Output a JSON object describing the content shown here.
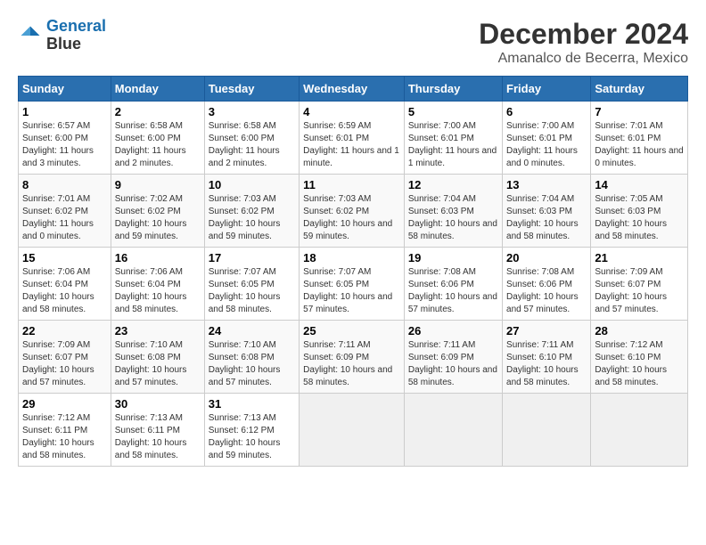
{
  "logo": {
    "line1": "General",
    "line2": "Blue"
  },
  "title": "December 2024",
  "subtitle": "Amanalco de Becerra, Mexico",
  "days_of_week": [
    "Sunday",
    "Monday",
    "Tuesday",
    "Wednesday",
    "Thursday",
    "Friday",
    "Saturday"
  ],
  "weeks": [
    [
      {
        "num": "1",
        "rise": "6:57 AM",
        "set": "6:00 PM",
        "daylight": "11 hours and 3 minutes."
      },
      {
        "num": "2",
        "rise": "6:58 AM",
        "set": "6:00 PM",
        "daylight": "11 hours and 2 minutes."
      },
      {
        "num": "3",
        "rise": "6:58 AM",
        "set": "6:00 PM",
        "daylight": "11 hours and 2 minutes."
      },
      {
        "num": "4",
        "rise": "6:59 AM",
        "set": "6:01 PM",
        "daylight": "11 hours and 1 minute."
      },
      {
        "num": "5",
        "rise": "7:00 AM",
        "set": "6:01 PM",
        "daylight": "11 hours and 1 minute."
      },
      {
        "num": "6",
        "rise": "7:00 AM",
        "set": "6:01 PM",
        "daylight": "11 hours and 0 minutes."
      },
      {
        "num": "7",
        "rise": "7:01 AM",
        "set": "6:01 PM",
        "daylight": "11 hours and 0 minutes."
      }
    ],
    [
      {
        "num": "8",
        "rise": "7:01 AM",
        "set": "6:02 PM",
        "daylight": "11 hours and 0 minutes."
      },
      {
        "num": "9",
        "rise": "7:02 AM",
        "set": "6:02 PM",
        "daylight": "10 hours and 59 minutes."
      },
      {
        "num": "10",
        "rise": "7:03 AM",
        "set": "6:02 PM",
        "daylight": "10 hours and 59 minutes."
      },
      {
        "num": "11",
        "rise": "7:03 AM",
        "set": "6:02 PM",
        "daylight": "10 hours and 59 minutes."
      },
      {
        "num": "12",
        "rise": "7:04 AM",
        "set": "6:03 PM",
        "daylight": "10 hours and 58 minutes."
      },
      {
        "num": "13",
        "rise": "7:04 AM",
        "set": "6:03 PM",
        "daylight": "10 hours and 58 minutes."
      },
      {
        "num": "14",
        "rise": "7:05 AM",
        "set": "6:03 PM",
        "daylight": "10 hours and 58 minutes."
      }
    ],
    [
      {
        "num": "15",
        "rise": "7:06 AM",
        "set": "6:04 PM",
        "daylight": "10 hours and 58 minutes."
      },
      {
        "num": "16",
        "rise": "7:06 AM",
        "set": "6:04 PM",
        "daylight": "10 hours and 58 minutes."
      },
      {
        "num": "17",
        "rise": "7:07 AM",
        "set": "6:05 PM",
        "daylight": "10 hours and 58 minutes."
      },
      {
        "num": "18",
        "rise": "7:07 AM",
        "set": "6:05 PM",
        "daylight": "10 hours and 57 minutes."
      },
      {
        "num": "19",
        "rise": "7:08 AM",
        "set": "6:06 PM",
        "daylight": "10 hours and 57 minutes."
      },
      {
        "num": "20",
        "rise": "7:08 AM",
        "set": "6:06 PM",
        "daylight": "10 hours and 57 minutes."
      },
      {
        "num": "21",
        "rise": "7:09 AM",
        "set": "6:07 PM",
        "daylight": "10 hours and 57 minutes."
      }
    ],
    [
      {
        "num": "22",
        "rise": "7:09 AM",
        "set": "6:07 PM",
        "daylight": "10 hours and 57 minutes."
      },
      {
        "num": "23",
        "rise": "7:10 AM",
        "set": "6:08 PM",
        "daylight": "10 hours and 57 minutes."
      },
      {
        "num": "24",
        "rise": "7:10 AM",
        "set": "6:08 PM",
        "daylight": "10 hours and 57 minutes."
      },
      {
        "num": "25",
        "rise": "7:11 AM",
        "set": "6:09 PM",
        "daylight": "10 hours and 58 minutes."
      },
      {
        "num": "26",
        "rise": "7:11 AM",
        "set": "6:09 PM",
        "daylight": "10 hours and 58 minutes."
      },
      {
        "num": "27",
        "rise": "7:11 AM",
        "set": "6:10 PM",
        "daylight": "10 hours and 58 minutes."
      },
      {
        "num": "28",
        "rise": "7:12 AM",
        "set": "6:10 PM",
        "daylight": "10 hours and 58 minutes."
      }
    ],
    [
      {
        "num": "29",
        "rise": "7:12 AM",
        "set": "6:11 PM",
        "daylight": "10 hours and 58 minutes."
      },
      {
        "num": "30",
        "rise": "7:13 AM",
        "set": "6:11 PM",
        "daylight": "10 hours and 58 minutes."
      },
      {
        "num": "31",
        "rise": "7:13 AM",
        "set": "6:12 PM",
        "daylight": "10 hours and 59 minutes."
      },
      null,
      null,
      null,
      null
    ]
  ]
}
